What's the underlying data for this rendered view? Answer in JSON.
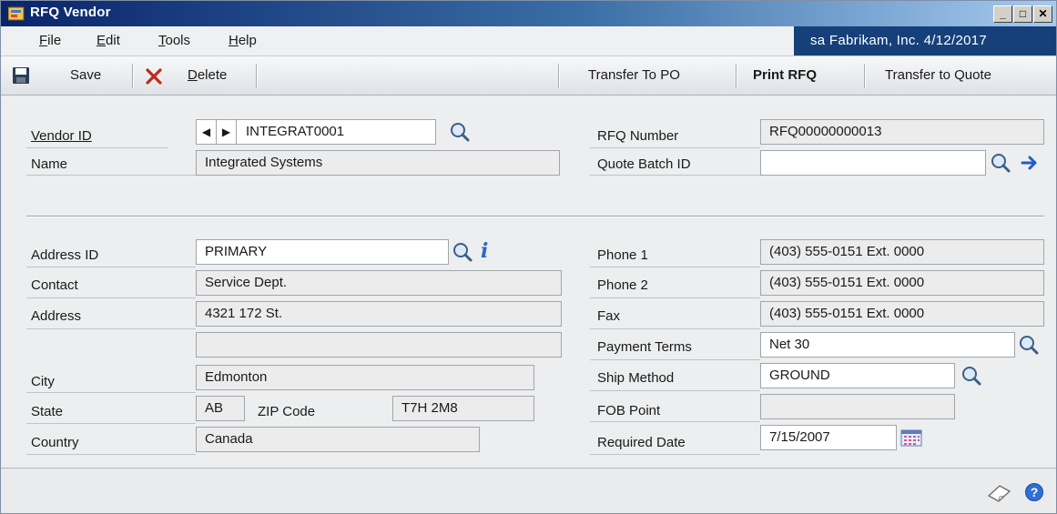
{
  "window": {
    "title": "RFQ Vendor"
  },
  "menu": {
    "items": [
      {
        "pre": "",
        "u": "F",
        "post": "ile"
      },
      {
        "pre": "",
        "u": "E",
        "post": "dit"
      },
      {
        "pre": "",
        "u": "T",
        "post": "ools"
      },
      {
        "pre": "",
        "u": "H",
        "post": "elp"
      }
    ]
  },
  "user": {
    "info": "sa  Fabrikam, Inc.  4/12/2017"
  },
  "toolbar": {
    "save": "Save",
    "delete_pre": "",
    "delete_u": "D",
    "delete_post": "elete",
    "transfer_po": "Transfer To PO",
    "print_rfq": "Print RFQ",
    "transfer_quote": "Transfer to Quote"
  },
  "form": {
    "vendor_id_label": "Vendor ID",
    "vendor_id": "INTEGRAT0001",
    "name_label": "Name",
    "name": "Integrated Systems",
    "rfq_number_label": "RFQ Number",
    "rfq_number": "RFQ00000000013",
    "quote_batch_label": "Quote Batch ID",
    "quote_batch": "",
    "address_id_label": "Address ID",
    "address_id": "PRIMARY",
    "contact_label": "Contact",
    "contact": "Service Dept.",
    "address_label": "Address",
    "address1": "4321 172 St.",
    "address2": "",
    "city_label": "City",
    "city": "Edmonton",
    "state_label": "State",
    "state": "AB",
    "zip_label": "ZIP Code",
    "zip": "T7H 2M8",
    "country_label": "Country",
    "country": "Canada",
    "phone1_label": "Phone 1",
    "phone1": "(403) 555-0151  Ext. 0000",
    "phone2_label": "Phone 2",
    "phone2": "(403) 555-0151  Ext. 0000",
    "fax_label": "Fax",
    "fax": "(403) 555-0151  Ext. 0000",
    "payment_terms_label": "Payment Terms",
    "payment_terms": "Net 30",
    "ship_method_label": "Ship Method",
    "ship_method": "GROUND",
    "fob_label": "FOB Point",
    "fob": "",
    "required_date_label": "Required Date",
    "required_date": "7/15/2007"
  },
  "icons": {
    "lookup": "magnifier-icon",
    "info": "info-icon",
    "calendar": "calendar-icon",
    "note": "note-icon",
    "help": "help-icon"
  }
}
